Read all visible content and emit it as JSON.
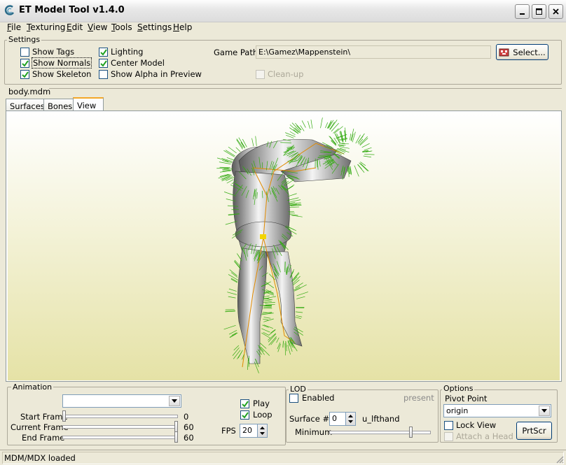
{
  "window": {
    "title": "ET Model Tool v1.4.0",
    "icon": "app-logo-icon",
    "controls": [
      "minimize-icon",
      "maximize-icon",
      "close-icon"
    ]
  },
  "menu": [
    "File",
    "Texturing",
    "Edit",
    "View",
    "Tools",
    "Settings",
    "Help"
  ],
  "settings": {
    "group_label": "Settings",
    "show_tags": {
      "label": "Show Tags",
      "checked": false
    },
    "show_normals": {
      "label": "Show Normals",
      "checked": true
    },
    "show_skeleton": {
      "label": "Show Skeleton",
      "checked": true
    },
    "lighting": {
      "label": "Lighting",
      "checked": true
    },
    "center_model": {
      "label": "Center Model",
      "checked": true
    },
    "show_alpha": {
      "label": "Show Alpha in Preview",
      "checked": false
    },
    "game_path_label": "Game Path",
    "game_path_value": "E:\\Gamez\\Mappenstein\\",
    "select_button": "Select...",
    "cleanup": {
      "label": "Clean-up",
      "checked": false,
      "enabled": false
    }
  },
  "model_file": "body.mdm",
  "tabs": [
    {
      "label": "Surfaces",
      "active": false
    },
    {
      "label": "Bones",
      "active": false
    },
    {
      "label": "View",
      "active": true
    }
  ],
  "viewport": {
    "bg_top": "#FFFFFF",
    "bg_bottom": "#E5E2A6",
    "normals_color": "#33AA11",
    "skeleton_color": "#E08A00"
  },
  "animation": {
    "group_label": "Animation",
    "selected": "",
    "start_frame_label": "Start Frame",
    "start_frame_value": "0",
    "current_frame_label": "Current Frame",
    "current_frame_value": "60",
    "end_frame_label": "End Frame",
    "end_frame_value": "60",
    "play": {
      "label": "Play",
      "checked": true
    },
    "loop": {
      "label": "Loop",
      "checked": true
    },
    "fps_label": "FPS",
    "fps_value": "20"
  },
  "lod": {
    "group_label": "LOD",
    "enabled": {
      "label": "Enabled",
      "checked": false
    },
    "status": "present",
    "surface_label": "Surface #",
    "surface_value": "0",
    "surface_name": "u_lfthand",
    "minimum_label": "Minimum"
  },
  "options": {
    "group_label": "Options",
    "pivot_label": "Pivot Point",
    "pivot_value": "origin",
    "lock_view": {
      "label": "Lock View",
      "checked": false
    },
    "attach_head": {
      "label": "Attach a Head",
      "checked": false,
      "enabled": false
    },
    "prtscr_button": "PrtScr"
  },
  "status_bar": "MDM/MDX loaded"
}
